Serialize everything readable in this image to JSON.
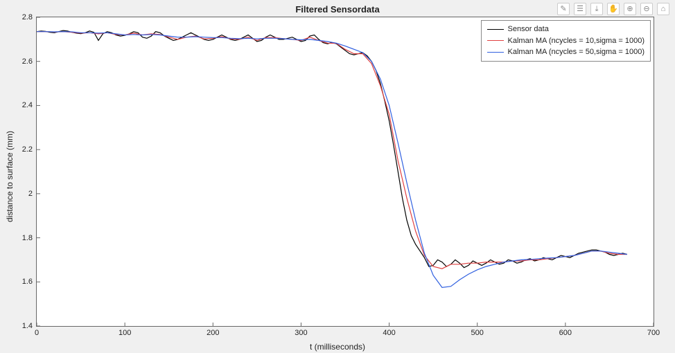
{
  "chart_data": {
    "type": "line",
    "title": "Filtered Sensordata",
    "xlabel": "t (milliseconds)",
    "ylabel": "distance to surface (mm)",
    "xlim": [
      0,
      700
    ],
    "ylim": [
      1.4,
      2.8
    ],
    "xticks": [
      0,
      100,
      200,
      300,
      400,
      500,
      600,
      700
    ],
    "yticks": [
      1.4,
      1.6,
      1.8,
      2.0,
      2.2,
      2.4,
      2.6,
      2.8
    ],
    "legend_position": "top-right",
    "series": [
      {
        "name": "Sensor data",
        "color": "#000000",
        "x": [
          0,
          5,
          10,
          15,
          20,
          25,
          30,
          35,
          40,
          45,
          50,
          55,
          60,
          65,
          70,
          75,
          80,
          85,
          90,
          95,
          100,
          105,
          110,
          115,
          120,
          125,
          130,
          135,
          140,
          145,
          150,
          155,
          160,
          165,
          170,
          175,
          180,
          185,
          190,
          195,
          200,
          205,
          210,
          215,
          220,
          225,
          230,
          235,
          240,
          245,
          250,
          255,
          260,
          265,
          270,
          275,
          280,
          285,
          290,
          295,
          300,
          305,
          310,
          315,
          320,
          325,
          330,
          335,
          340,
          345,
          350,
          355,
          360,
          365,
          370,
          375,
          380,
          385,
          390,
          395,
          400,
          405,
          410,
          415,
          420,
          425,
          430,
          435,
          440,
          445,
          450,
          455,
          460,
          465,
          470,
          475,
          480,
          485,
          490,
          495,
          500,
          505,
          510,
          515,
          520,
          525,
          530,
          535,
          540,
          545,
          550,
          555,
          560,
          565,
          570,
          575,
          580,
          585,
          590,
          595,
          600,
          605,
          610,
          615,
          620,
          625,
          630,
          635,
          640,
          645,
          650,
          655,
          660,
          665,
          670
        ],
        "y": [
          2.735,
          2.738,
          2.736,
          2.732,
          2.73,
          2.735,
          2.74,
          2.738,
          2.732,
          2.728,
          2.726,
          2.73,
          2.738,
          2.732,
          2.695,
          2.725,
          2.735,
          2.73,
          2.72,
          2.715,
          2.718,
          2.725,
          2.735,
          2.73,
          2.71,
          2.705,
          2.715,
          2.735,
          2.73,
          2.715,
          2.705,
          2.695,
          2.7,
          2.71,
          2.72,
          2.73,
          2.72,
          2.71,
          2.7,
          2.695,
          2.7,
          2.71,
          2.72,
          2.71,
          2.7,
          2.695,
          2.7,
          2.71,
          2.72,
          2.705,
          2.69,
          2.695,
          2.71,
          2.72,
          2.71,
          2.7,
          2.7,
          2.705,
          2.71,
          2.7,
          2.69,
          2.695,
          2.715,
          2.72,
          2.7,
          2.685,
          2.68,
          2.685,
          2.68,
          2.665,
          2.65,
          2.635,
          2.63,
          2.635,
          2.64,
          2.625,
          2.6,
          2.56,
          2.5,
          2.42,
          2.33,
          2.22,
          2.1,
          1.98,
          1.88,
          1.81,
          1.77,
          1.74,
          1.71,
          1.67,
          1.675,
          1.7,
          1.69,
          1.67,
          1.68,
          1.7,
          1.685,
          1.665,
          1.675,
          1.695,
          1.685,
          1.675,
          1.685,
          1.7,
          1.69,
          1.68,
          1.685,
          1.7,
          1.695,
          1.685,
          1.69,
          1.7,
          1.705,
          1.695,
          1.7,
          1.71,
          1.705,
          1.7,
          1.71,
          1.72,
          1.715,
          1.71,
          1.72,
          1.73,
          1.735,
          1.74,
          1.745,
          1.745,
          1.74,
          1.735,
          1.725,
          1.72,
          1.725,
          1.73,
          1.725
        ]
      },
      {
        "name": "Kalman MA (ncycles = 10,sigma = 1000)",
        "color": "#e04040",
        "x": [
          0,
          10,
          20,
          30,
          40,
          50,
          60,
          70,
          80,
          90,
          100,
          110,
          120,
          130,
          140,
          150,
          160,
          170,
          180,
          190,
          200,
          210,
          220,
          230,
          240,
          250,
          260,
          270,
          280,
          290,
          300,
          310,
          320,
          330,
          340,
          350,
          360,
          370,
          380,
          390,
          400,
          410,
          420,
          430,
          440,
          450,
          460,
          470,
          480,
          490,
          500,
          510,
          520,
          530,
          540,
          550,
          560,
          570,
          580,
          590,
          600,
          610,
          620,
          630,
          640,
          650,
          660,
          670
        ],
        "y": [
          2.735,
          2.735,
          2.733,
          2.735,
          2.732,
          2.728,
          2.73,
          2.725,
          2.73,
          2.722,
          2.72,
          2.728,
          2.72,
          2.725,
          2.722,
          2.71,
          2.7,
          2.71,
          2.715,
          2.702,
          2.705,
          2.712,
          2.702,
          2.7,
          2.71,
          2.695,
          2.708,
          2.708,
          2.703,
          2.7,
          2.695,
          2.71,
          2.695,
          2.683,
          2.682,
          2.655,
          2.635,
          2.635,
          2.59,
          2.49,
          2.36,
          2.15,
          1.98,
          1.83,
          1.72,
          1.67,
          1.66,
          1.68,
          1.68,
          1.685,
          1.685,
          1.69,
          1.69,
          1.69,
          1.695,
          1.695,
          1.7,
          1.7,
          1.705,
          1.71,
          1.715,
          1.72,
          1.73,
          1.74,
          1.74,
          1.73,
          1.725,
          1.725
        ]
      },
      {
        "name": "Kalman MA (ncycles = 50,sigma = 1000)",
        "color": "#3060e0",
        "x": [
          0,
          10,
          20,
          30,
          40,
          50,
          60,
          70,
          80,
          90,
          100,
          110,
          120,
          130,
          140,
          150,
          160,
          170,
          180,
          190,
          200,
          210,
          220,
          230,
          240,
          250,
          260,
          270,
          280,
          290,
          300,
          310,
          320,
          330,
          340,
          350,
          360,
          370,
          380,
          390,
          400,
          410,
          420,
          430,
          440,
          450,
          460,
          470,
          480,
          490,
          500,
          510,
          520,
          530,
          540,
          550,
          560,
          570,
          580,
          590,
          600,
          610,
          620,
          630,
          640,
          650,
          660,
          670
        ],
        "y": [
          2.735,
          2.735,
          2.734,
          2.735,
          2.734,
          2.73,
          2.73,
          2.728,
          2.73,
          2.725,
          2.72,
          2.722,
          2.72,
          2.722,
          2.72,
          2.715,
          2.71,
          2.71,
          2.712,
          2.71,
          2.708,
          2.708,
          2.705,
          2.703,
          2.705,
          2.702,
          2.705,
          2.705,
          2.703,
          2.7,
          2.698,
          2.7,
          2.695,
          2.69,
          2.683,
          2.67,
          2.655,
          2.64,
          2.6,
          2.52,
          2.4,
          2.23,
          2.05,
          1.88,
          1.73,
          1.63,
          1.575,
          1.58,
          1.61,
          1.635,
          1.655,
          1.67,
          1.68,
          1.69,
          1.695,
          1.7,
          1.702,
          1.705,
          1.708,
          1.71,
          1.715,
          1.72,
          1.73,
          1.74,
          1.74,
          1.735,
          1.73,
          1.725
        ]
      }
    ]
  },
  "toolbar": {
    "icons": [
      "brush",
      "cursor",
      "save",
      "pan",
      "zoom-in",
      "zoom-out",
      "home"
    ]
  }
}
